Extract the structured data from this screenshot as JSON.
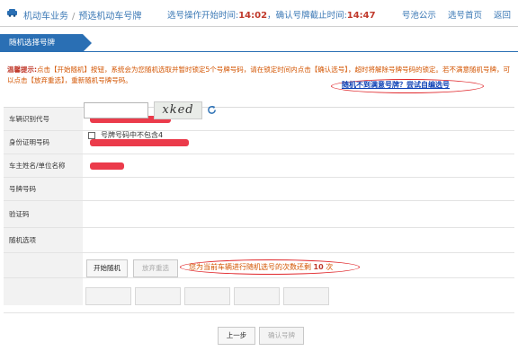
{
  "header": {
    "breadcrumb_root": "机动车业务",
    "breadcrumb_sep": "/",
    "breadcrumb_current": "预选机动车号牌",
    "start_label": "选号操作开始时间:",
    "start_time": "14:02",
    "confirm_label": "确认号牌截止时间:",
    "confirm_time": "14:47",
    "nav": [
      "号池公示",
      "选号首页",
      "返回"
    ]
  },
  "section_title": "随机选择号牌",
  "tip": {
    "label": "温馨提示:",
    "text": "点击【开始随机】按钮，系统会为您随机选取并暂时锁定5个号牌号码，请在锁定时间内点击【确认选号】，超时将解除号牌号码的锁定。若不满意随机号牌，可以点击【放弃重选】，重新随机号牌号码。",
    "custom_link": "随机不到满意号牌？尝试自编选号"
  },
  "form": {
    "rows": [
      {
        "label": "车辆识别代号"
      },
      {
        "label": "身份证明号码"
      },
      {
        "label": "车主姓名/单位名称"
      },
      {
        "label": "号牌号码"
      },
      {
        "label": "验证码"
      },
      {
        "label": "随机选项"
      }
    ],
    "captcha_text": "xked",
    "exclude_four_label": "号牌号码中不包含4"
  },
  "actions": {
    "start_random": "开始随机",
    "abandon_reselect": "放弃重选",
    "remaining_prefix": "您为当前车辆进行随机选号的次数还剩",
    "remaining_count": "10",
    "remaining_suffix": "次"
  },
  "footer": {
    "prev_button": "上一步",
    "confirm_button": "确认号牌"
  },
  "colors": {
    "accent": "#2a6fb4",
    "link": "#3b78b5",
    "warning": "#d35400",
    "highlight_oval": "#e0262a"
  }
}
